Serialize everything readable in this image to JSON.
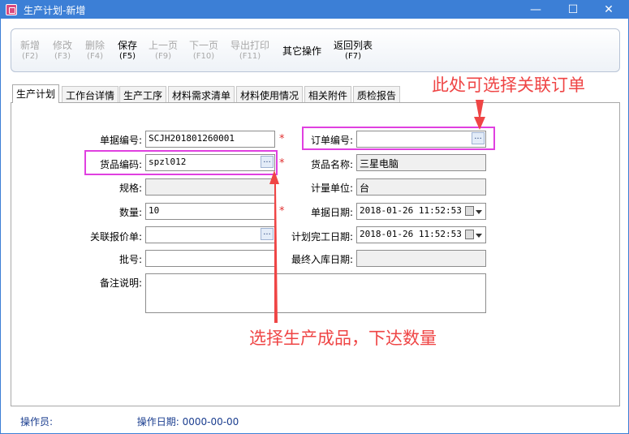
{
  "window": {
    "title": "生产计划-新增"
  },
  "toolbar": {
    "buttons": [
      {
        "label": "新增",
        "key": "(F2)"
      },
      {
        "label": "修改",
        "key": "(F3)"
      },
      {
        "label": "删除",
        "key": "(F4)"
      },
      {
        "label": "保存",
        "key": "(F5)"
      },
      {
        "label": "上一页",
        "key": "(F9)"
      },
      {
        "label": "下一页",
        "key": "(F10)"
      },
      {
        "label": "导出打印",
        "key": "(F11)"
      },
      {
        "label": "其它操作",
        "key": ""
      },
      {
        "label": "返回列表",
        "key": "(F7)"
      }
    ]
  },
  "tabs": [
    "生产计划",
    "工作台详情",
    "生产工序",
    "材料需求清单",
    "材料使用情况",
    "相关附件",
    "质检报告"
  ],
  "form": {
    "doc_no": {
      "label": "单据编号:",
      "value": "SCJH201801260001"
    },
    "order_no": {
      "label": "订单编号:",
      "value": ""
    },
    "product_code": {
      "label": "货品编码:",
      "value": "spzl012"
    },
    "product_name": {
      "label": "货品名称:",
      "value": "三星电脑"
    },
    "spec": {
      "label": "规格:",
      "value": ""
    },
    "unit": {
      "label": "计量单位:",
      "value": "台"
    },
    "quantity": {
      "label": "数量:",
      "value": "10"
    },
    "doc_date": {
      "label": "单据日期:",
      "value": "2018-01-26 11:52:53"
    },
    "quote": {
      "label": "关联报价单:",
      "value": ""
    },
    "plan_finish_date": {
      "label": "计划完工日期:",
      "value": "2018-01-26 11:52:53"
    },
    "batch_no": {
      "label": "批号:",
      "value": ""
    },
    "final_stock_date": {
      "label": "最终入库日期:",
      "value": ""
    },
    "remark": {
      "label": "备注说明:",
      "value": ""
    },
    "required_mark": "*",
    "ellipsis": "..."
  },
  "status": {
    "operator_label": "操作员:",
    "operator_value": "",
    "date_label": "操作日期:",
    "date_value": "0000-00-00"
  },
  "annotations": {
    "order_hint": "此处可选择关联订单",
    "product_hint": "选择生产成品，下达数量"
  },
  "colors": {
    "titlebar": "#3c7fd6",
    "highlight": "#e040e0",
    "annotation": "#ef4545"
  }
}
